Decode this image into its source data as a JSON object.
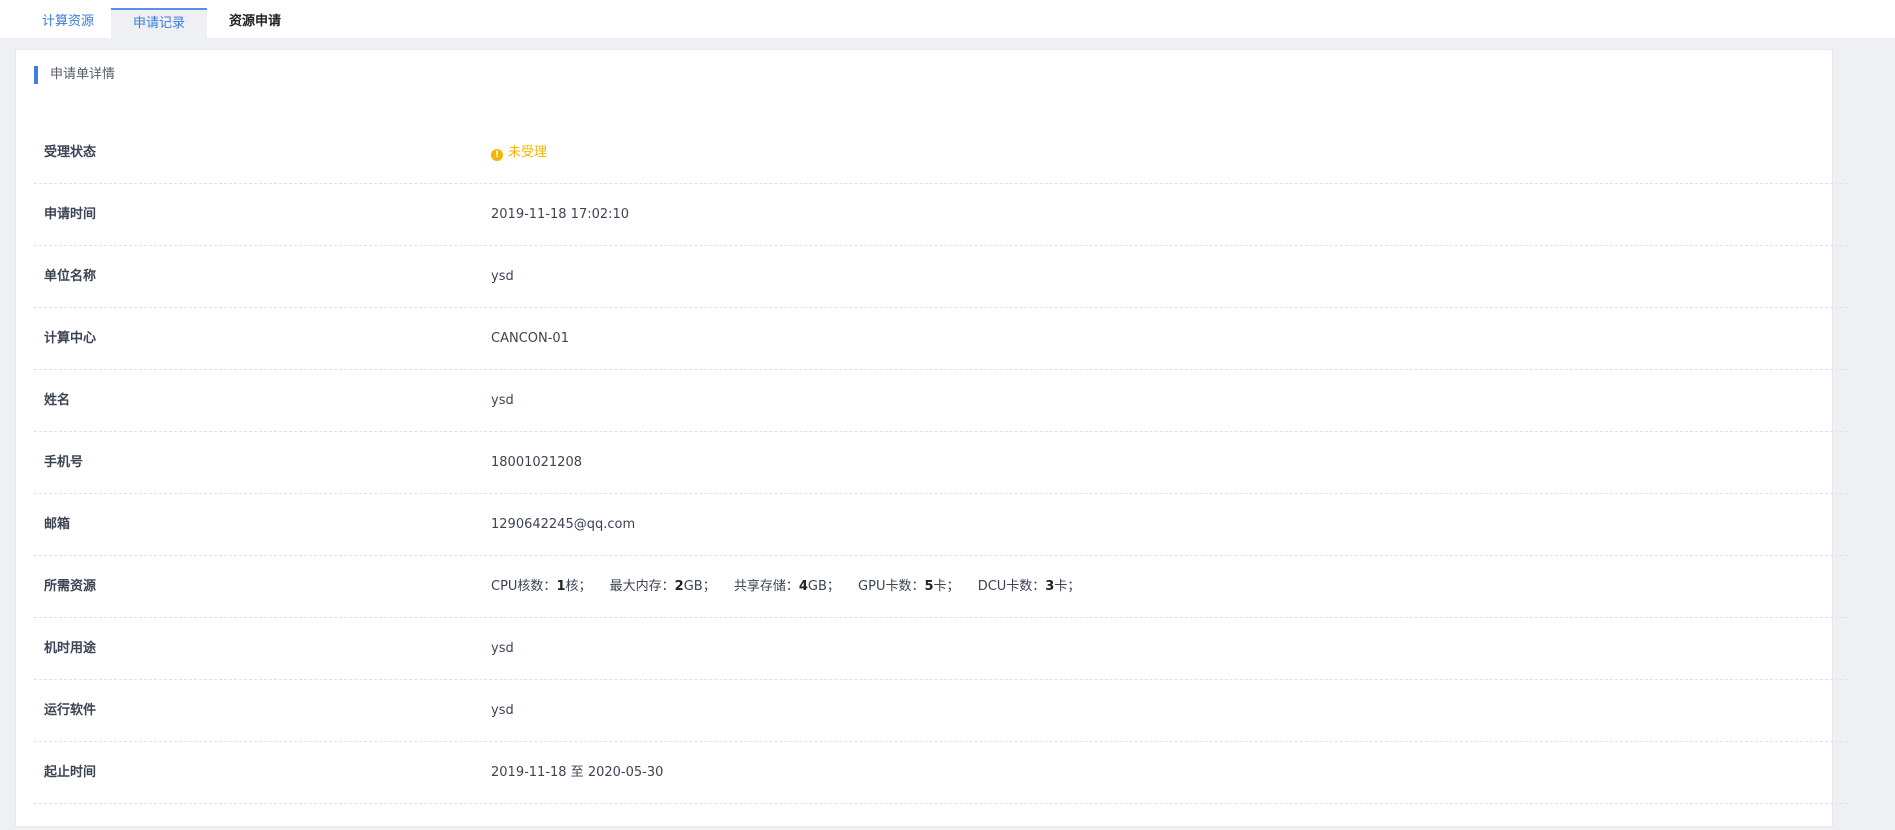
{
  "tabs": [
    {
      "label": "计算资源"
    },
    {
      "label": "申请记录"
    },
    {
      "label": "资源申请"
    }
  ],
  "section_title": "申请单详情",
  "fields": {
    "status": {
      "label": "受理状态",
      "value": "未受理"
    },
    "apply_time": {
      "label": "申请时间",
      "value": "2019-11-18 17:02:10"
    },
    "org": {
      "label": "单位名称",
      "value": "ysd"
    },
    "center": {
      "label": "计算中心",
      "value": "CANCON-01"
    },
    "name": {
      "label": "姓名",
      "value": "ysd"
    },
    "phone": {
      "label": "手机号",
      "value": "18001021208"
    },
    "email": {
      "label": "邮箱",
      "value": "1290642245@qq.com"
    },
    "resources": {
      "label": "所需资源",
      "items": [
        {
          "prefix": "CPU核数：",
          "num": "1",
          "suffix": "核；"
        },
        {
          "prefix": "最大内存：",
          "num": "2",
          "suffix": "GB；"
        },
        {
          "prefix": "共享存储：",
          "num": "4",
          "suffix": "GB；"
        },
        {
          "prefix": "GPU卡数：",
          "num": "5",
          "suffix": "卡；"
        },
        {
          "prefix": "DCU卡数：",
          "num": "3",
          "suffix": "卡；"
        }
      ]
    },
    "purpose": {
      "label": "机时用途",
      "value": "ysd"
    },
    "software": {
      "label": "运行软件",
      "value": "ysd"
    },
    "period": {
      "label": "起止时间",
      "value": "2019-11-18 至 2020-05-30"
    }
  },
  "icons": {
    "status": "warning-circle-icon"
  },
  "colors": {
    "accent": "#3f7fe3",
    "status_pending": "#f5b400"
  }
}
